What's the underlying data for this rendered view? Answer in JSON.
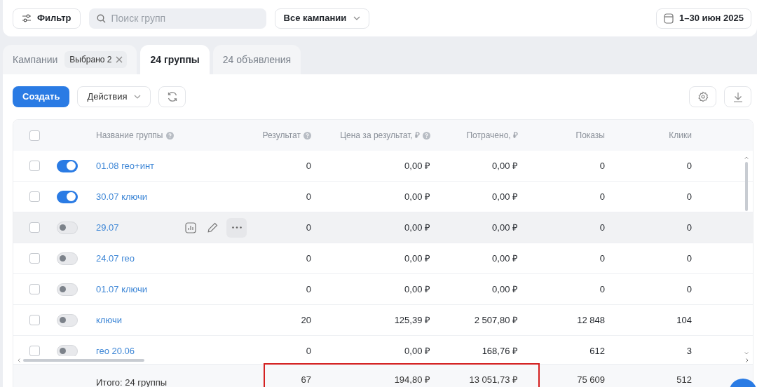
{
  "filter_button": "Фильтр",
  "search": {
    "placeholder": "Поиск групп"
  },
  "campaign_select": "Все кампании",
  "date_range": "1–30 июн 2025",
  "tabs": [
    {
      "label": "Кампании",
      "chip": "Выбрано 2",
      "selected": false
    },
    {
      "label": "24 группы",
      "selected": true
    },
    {
      "label": "24 объявления",
      "selected": false
    }
  ],
  "toolbar": {
    "create": "Создать",
    "actions": "Действия"
  },
  "table": {
    "all_checked": false,
    "columns": [
      {
        "label": "Название группы",
        "help": true
      },
      {
        "label": "Результат",
        "help": true
      },
      {
        "label": "Цена за результат, ₽",
        "help": true
      },
      {
        "label": "Потрачено, ₽",
        "help": false
      },
      {
        "label": "Показы",
        "help": false
      },
      {
        "label": "Клики",
        "help": false
      }
    ],
    "rows": [
      {
        "name": "01.08 гео+инт",
        "checked": false,
        "on": true,
        "hovered": false,
        "values": [
          "0",
          "0,00 ₽",
          "0,00 ₽",
          "0",
          "0"
        ]
      },
      {
        "name": "30.07 ключи",
        "checked": false,
        "on": true,
        "hovered": false,
        "values": [
          "0",
          "0,00 ₽",
          "0,00 ₽",
          "0",
          "0"
        ]
      },
      {
        "name": "29.07",
        "checked": false,
        "on": false,
        "hovered": true,
        "values": [
          "0",
          "0,00 ₽",
          "0,00 ₽",
          "0",
          "0"
        ]
      },
      {
        "name": "24.07 гео",
        "checked": false,
        "on": false,
        "hovered": false,
        "values": [
          "0",
          "0,00 ₽",
          "0,00 ₽",
          "0",
          "0"
        ]
      },
      {
        "name": "01.07 ключи",
        "checked": false,
        "on": false,
        "hovered": false,
        "values": [
          "0",
          "0,00 ₽",
          "0,00 ₽",
          "0",
          "0"
        ]
      },
      {
        "name": "ключи",
        "checked": false,
        "on": false,
        "hovered": false,
        "values": [
          "20",
          "125,39 ₽",
          "2 507,80 ₽",
          "12 848",
          "104"
        ]
      },
      {
        "name": "гео 20.06",
        "checked": false,
        "on": false,
        "hovered": false,
        "values": [
          "0",
          "0,00 ₽",
          "168,76 ₽",
          "612",
          "3"
        ]
      }
    ],
    "total": {
      "label": "Итого: 24 группы",
      "highlighted": true,
      "values": [
        "67",
        "194,80 ₽",
        "13 051,73 ₽",
        "75 609",
        "512"
      ]
    }
  }
}
